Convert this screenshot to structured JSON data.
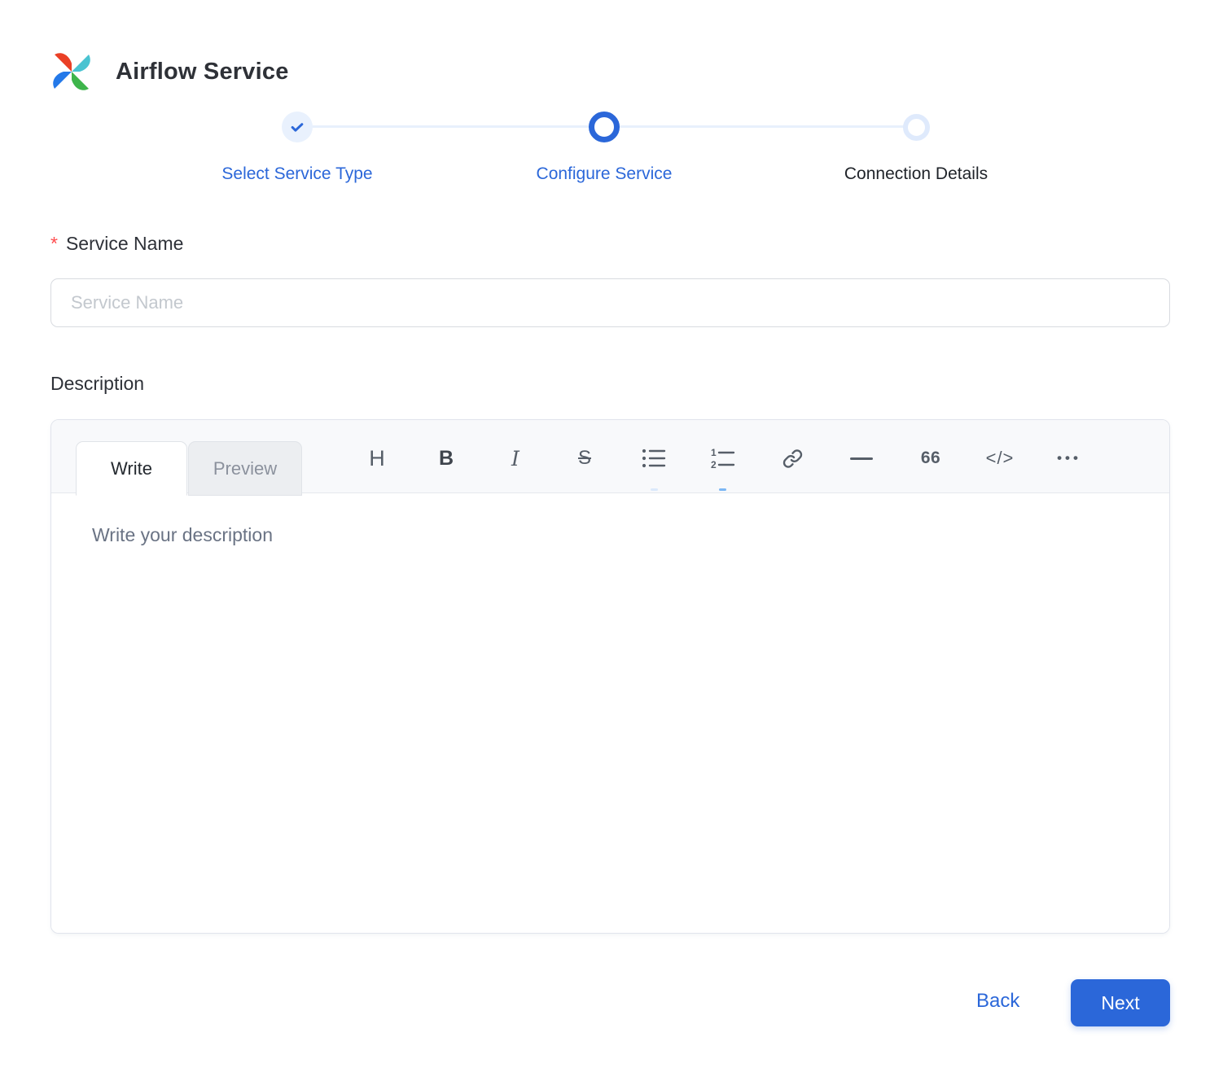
{
  "colors": {
    "primary": "#2b67d9",
    "required_marker": "#ff4d4f",
    "toolbar_icon": "#565e68",
    "stepper_track": "#e8f0fc",
    "pending_ring": "#dfeafc"
  },
  "header": {
    "title": "Airflow Service"
  },
  "stepper": {
    "steps": [
      {
        "label": "Select Service Type",
        "state": "completed"
      },
      {
        "label": "Configure Service",
        "state": "active"
      },
      {
        "label": "Connection Details",
        "state": "pending"
      }
    ]
  },
  "form": {
    "service_name": {
      "required_marker": "*",
      "label": "Service Name",
      "placeholder": "Service Name",
      "value": ""
    },
    "description": {
      "label": "Description"
    }
  },
  "editor": {
    "tabs": [
      {
        "label": "Write",
        "active": true
      },
      {
        "label": "Preview",
        "active": false
      }
    ],
    "toolbar": {
      "heading": "H",
      "bold": "B",
      "italic": "I",
      "strikethrough": "S",
      "quote": "66",
      "code": "</>",
      "more": "•••"
    },
    "placeholder": "Write your description",
    "value": ""
  },
  "footer": {
    "back_label": "Back",
    "next_label": "Next"
  }
}
